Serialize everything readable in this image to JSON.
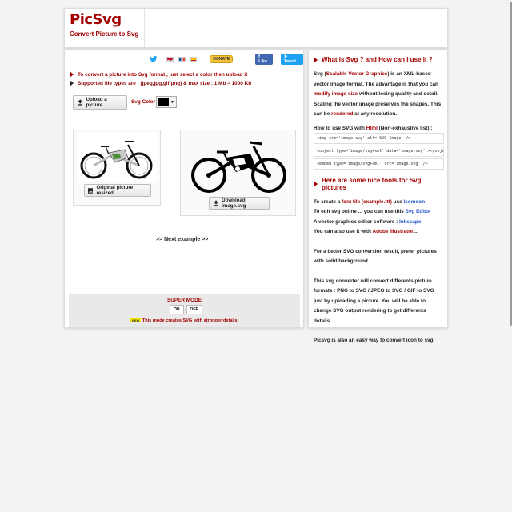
{
  "header": {
    "logo_title": "PicSvg",
    "logo_subtitle": "Convert Picture to Svg"
  },
  "social": {
    "donate_label": "DONATE",
    "like_label": "Like",
    "tweet_label": "Tweet"
  },
  "intro": {
    "line1": "To convert a picture into Svg format , just select a color then upload it",
    "line2": "Supported file types are : (jpeg,jpg,gif,png) & max size : 1 Mb = 1000 Kb"
  },
  "controls": {
    "upload_label": "Upload a picture",
    "svg_color_label": "Svg Color",
    "svg_color_value": "#000000"
  },
  "images": {
    "original_label": "Original picture resized",
    "download_label": "Download image.svg"
  },
  "next_example": ">> Next example >>",
  "super_mode": {
    "title": "SUPER MODE",
    "on_label": "ON",
    "off_label": "OFF",
    "new_badge": "NEW",
    "note": "This mode creates SVG with stronger details."
  },
  "right": {
    "heading1": "What is Svg ? and How can i use it ?",
    "p1_a": "Svg (",
    "p1_b": "Scalable Vector Graphics",
    "p1_c": ") is an XML-based vector image format. The advantage is that you can ",
    "p1_d": "modify image size",
    "p1_e": " without losing quality and detail. Scaling the vector image preserves the shapes. This can be ",
    "p1_f": "rendered",
    "p1_g": " at any resolution.",
    "howto_a": "How to use SVG with ",
    "howto_b": "Html",
    "howto_c": " (Non-exhaustive list) :",
    "code1": "<img src='image.svg' alt='SVG Image' />",
    "code2": "<object type='image/svg+xml' data='image.svg' ></object>",
    "code3": "<embed type='image/svg+xml' src='image.svg' />",
    "heading2": "Here are some nice tools for Svg pictures",
    "t1_a": "To create a ",
    "t1_b": "font file (example.ttf)",
    "t1_c": " use ",
    "t1_d": "Icomoon",
    "t2_a": "To edit svg online ... you can use this ",
    "t2_b": "Svg Editor",
    "t3_a": "A vector graphics editor software : ",
    "t3_b": "Inkscape",
    "t4_a": "You can also use it with ",
    "t4_b": "Adobe Illustrator",
    "t4_c": "...",
    "p2": "For a better SVG conversion result, prefer pictures with solid background.",
    "p3": "This svg converter will convert differents picture formats : PNG to SVG / JPEG to SVG / GIF to SVG just by uploading a picture. You will be able to change SVG output rendering to get differents details.",
    "p4": "Picsvg is also an easy way to convert icon to svg."
  }
}
